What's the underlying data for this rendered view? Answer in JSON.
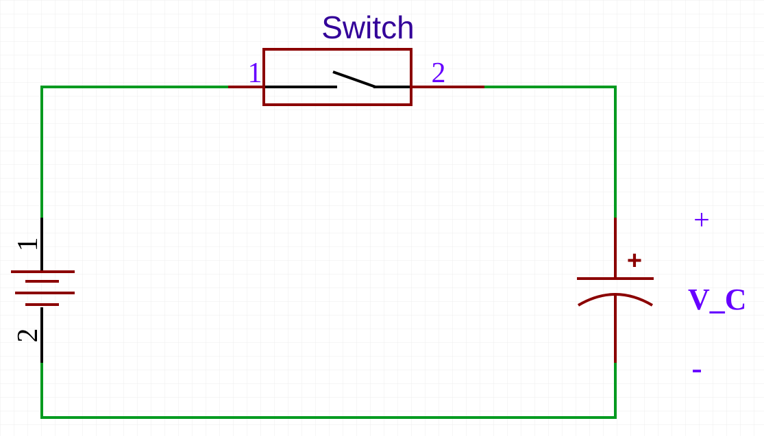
{
  "schematic": {
    "switch": {
      "label": "Switch",
      "pin1": "1",
      "pin2": "2"
    },
    "battery": {
      "pin1": "1",
      "pin2": "2"
    },
    "capacitor": {
      "polarity_mark": "+"
    },
    "probe": {
      "plus": "+",
      "name": "V_C",
      "minus": "-"
    }
  },
  "colors": {
    "wire": "#009a1f",
    "component": "#8b0000",
    "pin_lead": "#000000",
    "pin_label": "#6600ff",
    "title_label": "#330099",
    "grid": "#ececec"
  }
}
